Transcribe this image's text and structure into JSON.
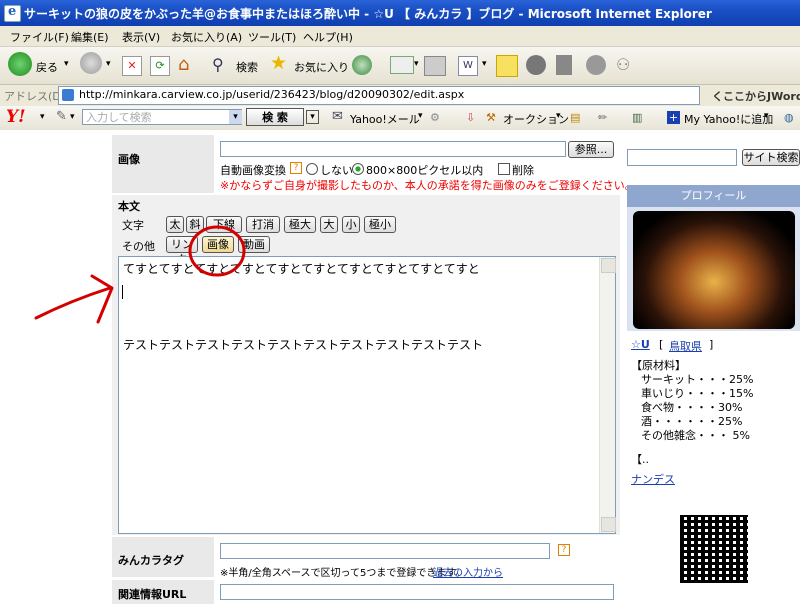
{
  "window": {
    "title": "サーキットの狼の皮をかぶった羊@お食事中またはほろ酔い中 - ☆U 【 みんカラ 】ブログ - Microsoft Internet Explorer"
  },
  "menu": [
    "ファイル(F)",
    "編集(E)",
    "表示(V)",
    "お気に入り(A)",
    "ツール(T)",
    "ヘルプ(H)"
  ],
  "toolbar": {
    "back_label": "戻る",
    "search_label": "検索",
    "favorites_label": "お気に入り"
  },
  "address": {
    "label": "アドレス(D)",
    "url": "http://minkara.carview.co.jp/userid/236423/blog/d20090302/edit.aspx",
    "right_text": "くここからJWord検"
  },
  "yahoo_bar": {
    "search_placeholder": "入力して検索",
    "search_button": "検 索",
    "mail_label": "Yahoo!メール",
    "auction_label": "オークション",
    "my_yahoo_label": "My Yahoo!に追加"
  },
  "form": {
    "image_section_label": "画像",
    "browse_button": "参照...",
    "auto_convert_label": "自動画像変換",
    "radio_no": "しない",
    "radio_800": "800×800ピクセル以内",
    "delete_label": "削除",
    "warning": "※かならずご自身が撮影したものか、本人の承諾を得た画像のみをご登録ください。",
    "body_label": "本文",
    "text_row_label": "文字",
    "text_buttons": [
      "太",
      "斜",
      "下線",
      "打消",
      "極大",
      "大",
      "小",
      "極小"
    ],
    "other_row_label": "その他",
    "other_buttons": [
      "リンク",
      "画像",
      "動画"
    ],
    "body_line1": "てすとてすとてすとてすとてすとてすとてすとてすとてすとてすと",
    "body_line2": "テストテストテストテストテストテストテストテストテストテスト",
    "tag_label": "みんカラタグ",
    "tag_note": "※半角/全角スペースで区切って5つまで登録できます。",
    "tag_link": "過去の入力から",
    "related_url_label": "関連情報URL"
  },
  "sidebar": {
    "site_search_button": "サイト検索",
    "profile_header": "プロフィール",
    "user_name": "☆U",
    "region": "鳥取県",
    "ingredients_title": "【原材料】",
    "ingredients": [
      "サーキット・・・25%",
      "車いじり・・・・15%",
      "食べ物・・・・30%",
      "酒・・・・・・25%",
      "その他雑念・・・ 5%"
    ],
    "ellipsis": "【..",
    "link_text": "ナンデス"
  },
  "colors": {
    "annotation": "#d40000",
    "title_bar": "#1a4fc4",
    "profile_header": "#8fa6cf"
  }
}
